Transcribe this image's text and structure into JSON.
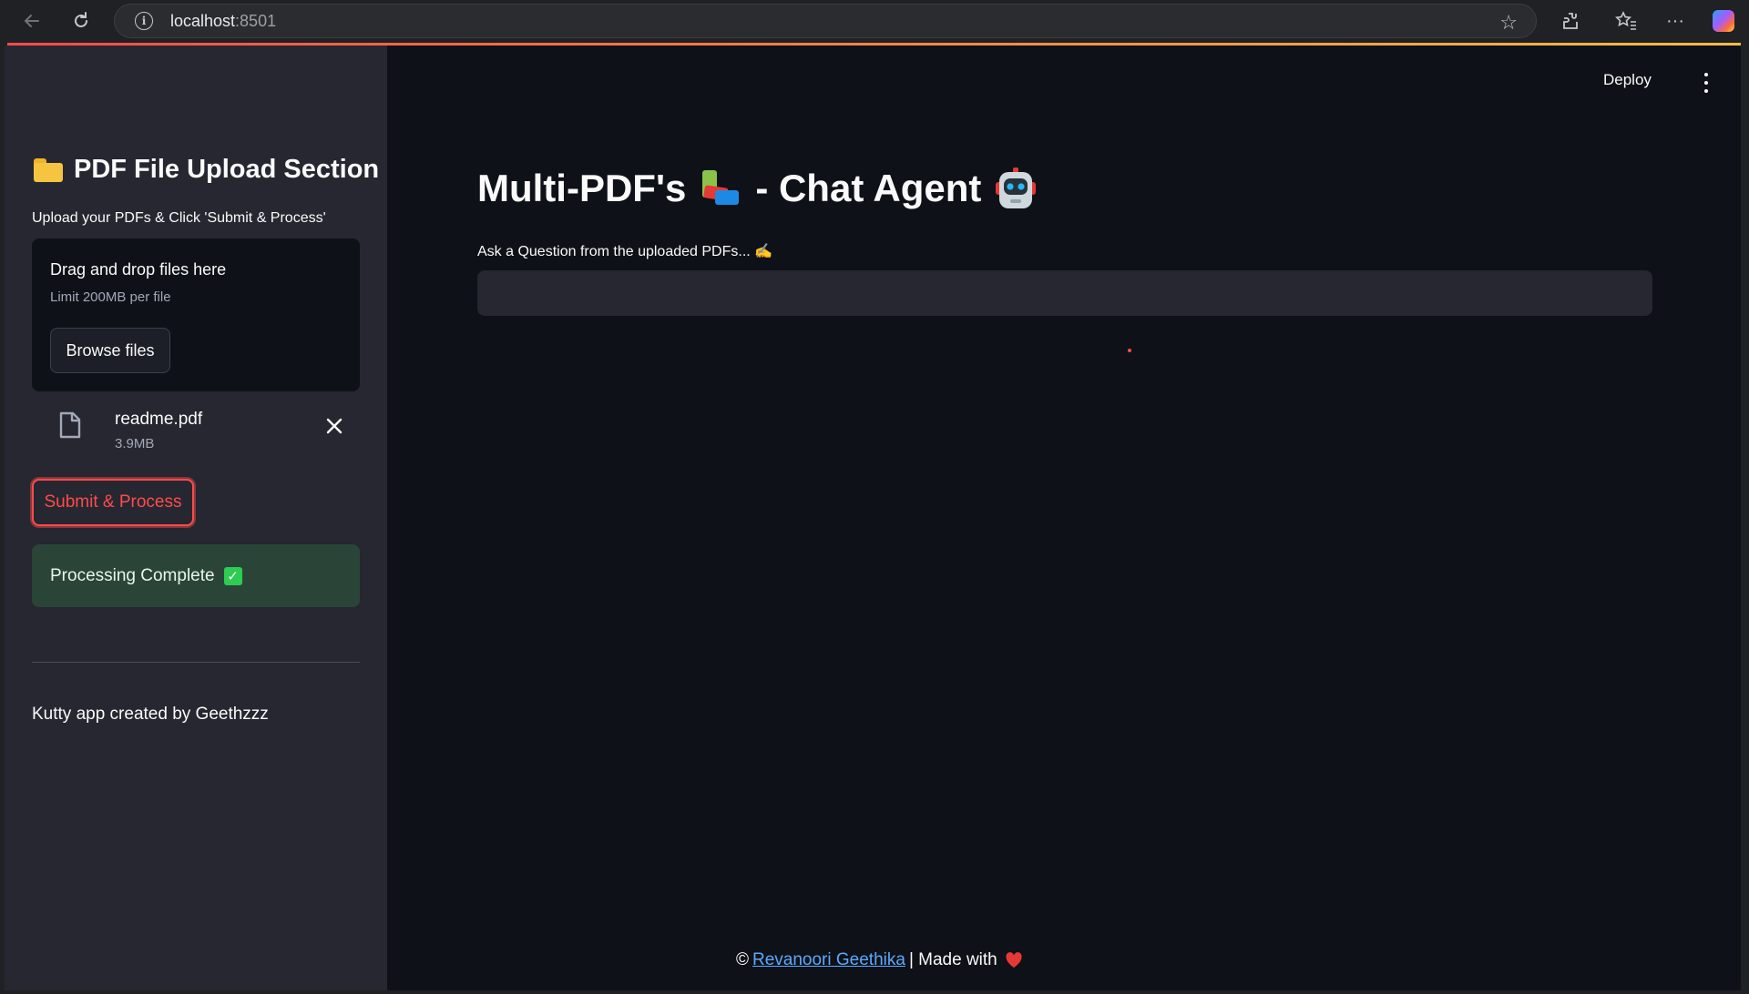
{
  "browser": {
    "url_host": "localhost",
    "url_port": ":8501"
  },
  "sidebar": {
    "title": "PDF File Upload Section",
    "subtitle": "Upload your PDFs & Click 'Submit & Process'",
    "dropzone": {
      "title": "Drag and drop files here",
      "limit": "Limit 200MB per file",
      "browse_label": "Browse files"
    },
    "file": {
      "name": "readme.pdf",
      "size": "3.9MB"
    },
    "submit_label": "Submit & Process",
    "success_text": "Processing Complete",
    "credit": "Kutty app created by Geethzzz"
  },
  "header": {
    "deploy_label": "Deploy"
  },
  "main": {
    "title_part1": "Multi-PDF's",
    "title_part2": "- Chat Agent",
    "ask_label": "Ask a Question from the uploaded PDFs... ✍️",
    "question_value": ""
  },
  "footer": {
    "copyright": "©",
    "author_link": "Revanoori Geethika",
    "made_with": "| Made with"
  },
  "colors": {
    "accent": "#ff4b4b",
    "sidebar_bg": "#262730",
    "main_bg": "#0e1117",
    "success_bg": "#2b4438",
    "link": "#5aa9ff"
  },
  "icons": [
    "back-icon",
    "reload-icon",
    "info-icon",
    "star-icon",
    "extensions-icon",
    "favorites-icon",
    "more-icon",
    "copilot-icon",
    "folder-icon",
    "file-icon",
    "close-icon",
    "check-icon",
    "books-icon",
    "robot-icon",
    "heart-icon",
    "kebab-menu-icon"
  ]
}
